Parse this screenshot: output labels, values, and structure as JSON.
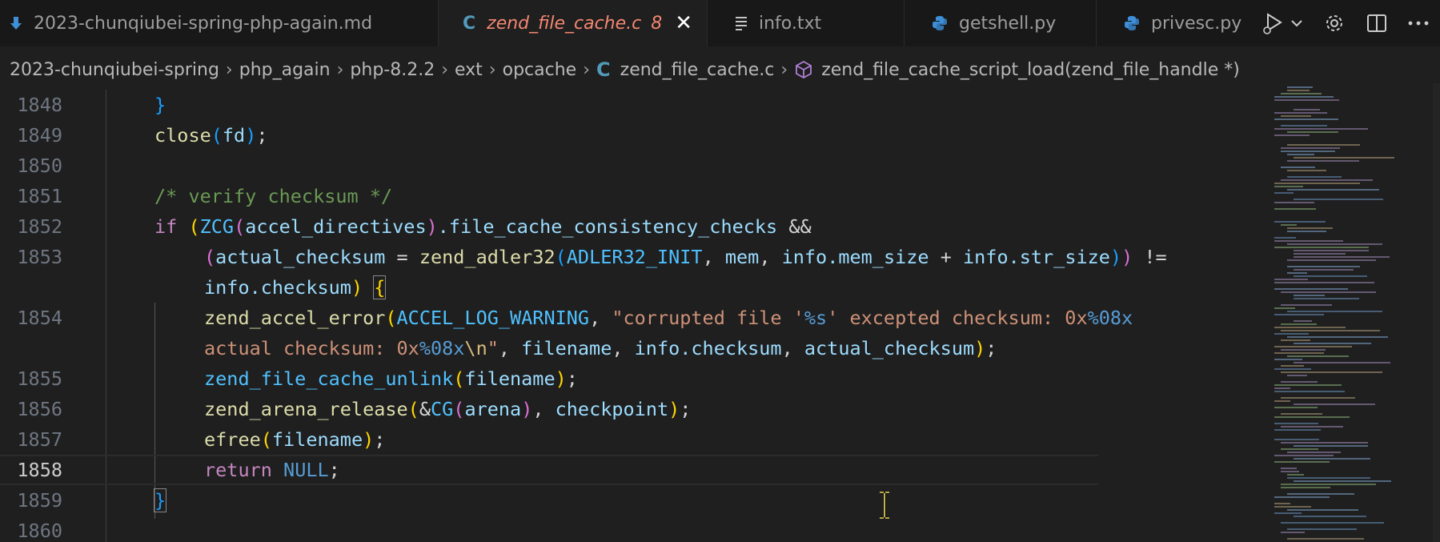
{
  "tabs": [
    {
      "name": "2023-chunqiubei-spring-php-again.md",
      "icon": "markdown-icon"
    },
    {
      "name": "zend_file_cache.c",
      "icon": "c-file-icon",
      "problems": "8",
      "active": true
    },
    {
      "name": "info.txt",
      "icon": "text-file-icon"
    },
    {
      "name": "getshell.py",
      "icon": "python-icon"
    },
    {
      "name": "privesc.py",
      "icon": "python-icon"
    }
  ],
  "tab_actions": [
    "run-debug-icon",
    "chevron-down-icon",
    "gear-icon",
    "split-editor-icon",
    "more-icon"
  ],
  "breadcrumb": {
    "items": [
      "2023-chunqiubei-spring",
      "php_again",
      "php-8.2.2",
      "ext",
      "opcache",
      "zend_file_cache.c"
    ],
    "symbol": "zend_file_cache_script_load(zend_file_handle *)"
  },
  "editor": {
    "current_line": "1858",
    "line_numbers": [
      "1848",
      "1849",
      "1850",
      "1851",
      "1852",
      "1853",
      "",
      "1854",
      "",
      "1855",
      "1856",
      "1857",
      "1858",
      "1859",
      "1860"
    ],
    "tokens": {
      "close": "close",
      "fd": "fd",
      "comment": "/* verify checksum */",
      "if": "if",
      "ZCG": "ZCG",
      "accel_directives": "accel_directives",
      "fccc": ".file_cache_consistency_checks",
      "and": "&&",
      "actual_checksum": "actual_checksum",
      "eq": " = ",
      "adler": "zend_adler32",
      "ADLER32_INIT": "ADLER32_INIT",
      "mem": "mem",
      "info_mem_size": "info.mem_size",
      "plus": " + ",
      "info_str_size": "info.str_size",
      "neq": " !=",
      "info_checksum": "info.checksum",
      "zae": "zend_accel_error",
      "ACCEL_LOG_WARNING": "ACCEL_LOG_WARNING",
      "str1": "\"corrupted file '",
      "fmt_s": "%s",
      "str2": "' excepted checksum: 0x",
      "fmt_08x": "%08x",
      "str3": "actual checksum: 0x",
      "nl": "\\n",
      "quote": "\"",
      "filename": "filename",
      "zfcu": "zend_file_cache_unlink",
      "zar": "zend_arena_release",
      "amp": "&",
      "CG": "CG",
      "arena": "arena",
      "checkpoint": "checkpoint",
      "efree": "efree",
      "return": "return",
      "NULL": "NULL"
    }
  }
}
